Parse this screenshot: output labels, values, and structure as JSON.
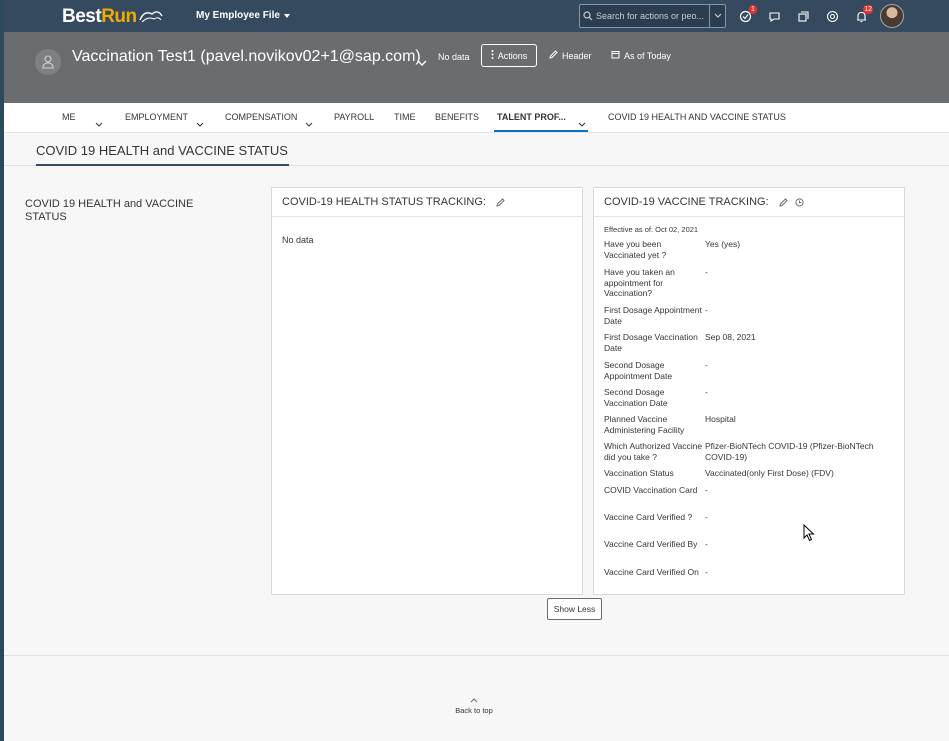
{
  "shell": {
    "logo_best": "Best",
    "logo_run": "Run",
    "app_title": "My Employee File",
    "search_placeholder": "Search for actions or peo...",
    "notif_badge": "1",
    "alerts_badge": "12"
  },
  "header": {
    "employee_name": "Vaccination Test1 (pavel.novikov02+1@sap.com)",
    "no_data": "No data",
    "actions_label": "Actions",
    "header_label": "Header",
    "as_of_label": "As of Today"
  },
  "tabs": [
    {
      "label": "ME"
    },
    {
      "label": "EMPLOYMENT"
    },
    {
      "label": "COMPENSATION"
    },
    {
      "label": "PAYROLL"
    },
    {
      "label": "TIME"
    },
    {
      "label": "BENEFITS"
    },
    {
      "label": "TALENT PROF..."
    },
    {
      "label": "COVID 19 HEALTH AND VACCINE STATUS"
    }
  ],
  "section": {
    "title": "COVID 19 HEALTH and VACCINE STATUS",
    "side_label": "COVID 19 HEALTH and VACCINE STATUS"
  },
  "health_card": {
    "title": "COVID-19 HEALTH STATUS TRACKING:",
    "no_data": "No data"
  },
  "vaccine_card": {
    "title": "COVID-19 VACCINE TRACKING:",
    "effective": "Effective as of: Oct 02, 2021",
    "fields": [
      {
        "label": "Have you been Vaccinated yet ?",
        "value": "Yes (yes)"
      },
      {
        "label": "Have you taken an appointment for Vaccination?",
        "value": "-"
      },
      {
        "label": "First Dosage Appointment Date",
        "value": "-"
      },
      {
        "label": "First Dosage Vaccination Date",
        "value": "Sep 08, 2021"
      },
      {
        "label": "Second Dosage Appointment Date",
        "value": "-"
      },
      {
        "label": "Second Dosage Vaccination Date",
        "value": "-"
      },
      {
        "label": "Planned Vaccine Administering Facility",
        "value": "Hospital"
      },
      {
        "label": "Which Authorized Vaccine did you take ?",
        "value": "Pfizer-BioNTech COVID-19 (Pfizer-BioNTech COVID-19)"
      },
      {
        "label": "Vaccination Status",
        "value": "Vaccinated(only First Dose) (FDV)"
      },
      {
        "label": "COVID Vaccination Card",
        "value": "-"
      },
      {
        "label": "Vaccine Card Verified ?",
        "value": "-"
      },
      {
        "label": "Vaccine Card Verified By",
        "value": "-"
      },
      {
        "label": "Vaccine Card Verified On",
        "value": "-"
      }
    ]
  },
  "show_less": "Show Less",
  "back_to_top": "Back to top"
}
